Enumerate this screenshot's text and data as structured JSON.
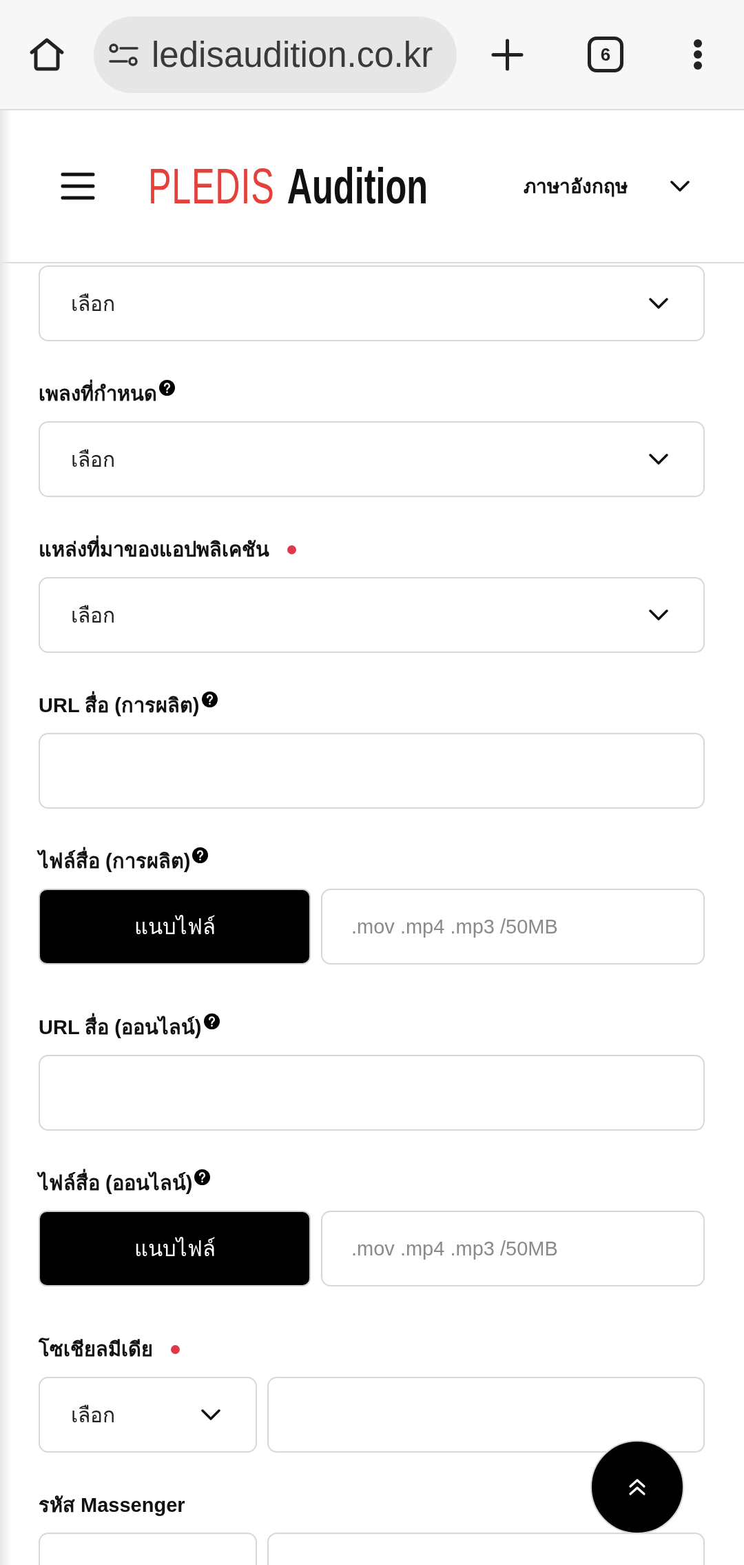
{
  "browser": {
    "url": "ledisaudition.co.kr",
    "tab_count": "6"
  },
  "header": {
    "logo": {
      "brand": "PLEDIS",
      "name": "Audition"
    },
    "language": "ภาษาอังกฤษ"
  },
  "form": {
    "fields": [
      {
        "kind": "select",
        "value": "เลือก"
      },
      {
        "kind": "select",
        "label": "เพลงที่กำหนด",
        "help": true,
        "required": false,
        "value": "เลือก"
      },
      {
        "kind": "select",
        "label": "แหล่งที่มาของแอปพลิเคชัน",
        "help": false,
        "required": true,
        "value": "เลือก"
      },
      {
        "kind": "text",
        "label": "URL สื่อ (การผลิต)",
        "help": true,
        "required": false
      },
      {
        "kind": "file",
        "label": "ไฟล์สื่อ (การผลิต)",
        "help": true,
        "required": false,
        "button": "แนบไฟล์",
        "placeholder": ".mov .mp4 .mp3 /50MB"
      },
      {
        "kind": "text",
        "label": "URL สื่อ (ออนไลน์)",
        "help": true,
        "required": false
      },
      {
        "kind": "file",
        "label": "ไฟล์สื่อ (ออนไลน์)",
        "help": true,
        "required": false,
        "button": "แนบไฟล์",
        "placeholder": ".mov .mp4 .mp3 /50MB"
      },
      {
        "kind": "select_text",
        "label": "โซเชียลมีเดีย",
        "help": false,
        "required": true,
        "value": "เลือก"
      },
      {
        "kind": "select_text",
        "label": "รหัส Massenger",
        "help": false,
        "required": false
      }
    ]
  }
}
